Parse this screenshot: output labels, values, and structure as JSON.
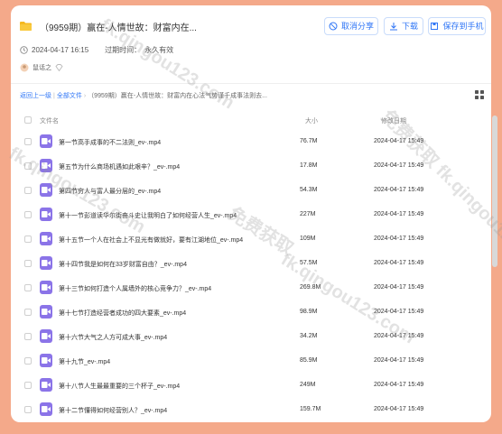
{
  "share": {
    "title": "（9959期）赢在-人情世故：财富内在...",
    "date": "2024-04-17 16:15",
    "expire_label": "过期时间：",
    "expire_value": "永久有效",
    "user": "鼠话之"
  },
  "buttons": {
    "cancel_share": "取消分享",
    "download": "下载",
    "save": "保存到手机"
  },
  "breadcrumb": {
    "back": "返回上一级",
    "all_files": "全部文件",
    "current": "（9959期）赢在-人情世故：财富内在心法气势谨千成事法则去..."
  },
  "table": {
    "col_name": "文件名",
    "col_size": "大小",
    "col_date": "修改日期"
  },
  "files": [
    {
      "name": "第一节高手成事的不二法则_ev-.mp4",
      "size": "76.7M",
      "date": "2024-04-17 15:49"
    },
    {
      "name": "第五节为什么商场机遇如此艰辛？_ev-.mp4",
      "size": "17.8M",
      "date": "2024-04-17 15:49"
    },
    {
      "name": "第四节穷人与富人最分层的_ev-.mp4",
      "size": "54.3M",
      "date": "2024-04-17 15:49"
    },
    {
      "name": "第十一节彭道读华尔街奋斗史让我明白了如何经营人生_ev-.mp4",
      "size": "227M",
      "date": "2024-04-17 15:49"
    },
    {
      "name": "第十五节一个人在社会上不显光有做就好，要有江湖地位_ev-.mp4",
      "size": "109M",
      "date": "2024-04-17 15:49"
    },
    {
      "name": "第十四节我是如何在33岁财富自由？_ev-.mp4",
      "size": "57.5M",
      "date": "2024-04-17 15:49"
    },
    {
      "name": "第十三节如何打造个人属墙外的核心竞争力？_ev-.mp4",
      "size": "269.8M",
      "date": "2024-04-17 15:49"
    },
    {
      "name": "第十七节打造经营者成功的四大要素_ev-.mp4",
      "size": "98.9M",
      "date": "2024-04-17 15:49"
    },
    {
      "name": "第十六节大气之人方可成大事_ev-.mp4",
      "size": "34.2M",
      "date": "2024-04-17 15:49"
    },
    {
      "name": "第十九节_ev-.mp4",
      "size": "85.9M",
      "date": "2024-04-17 15:49"
    },
    {
      "name": "第十八节人生最最重要的三个杯子_ev-.mp4",
      "size": "249M",
      "date": "2024-04-17 15:49"
    },
    {
      "name": "第十二节懂得如何经营别人？_ev-.mp4",
      "size": "159.7M",
      "date": "2024-04-17 15:49"
    }
  ],
  "watermarks": {
    "a": "fk.qingou123.com",
    "b": "免费获取",
    "c": "免费获取 fk.qingou123.com"
  },
  "icons": {
    "folder": "folder-icon",
    "cancel": "cancel-circle-icon",
    "download": "download-icon",
    "save": "save-phone-icon",
    "grid": "grid-view-icon",
    "file": "video-file-icon"
  },
  "colors": {
    "background": "#f4a98a",
    "accent": "#2f76f6",
    "file_icon": "#8b74e8"
  }
}
